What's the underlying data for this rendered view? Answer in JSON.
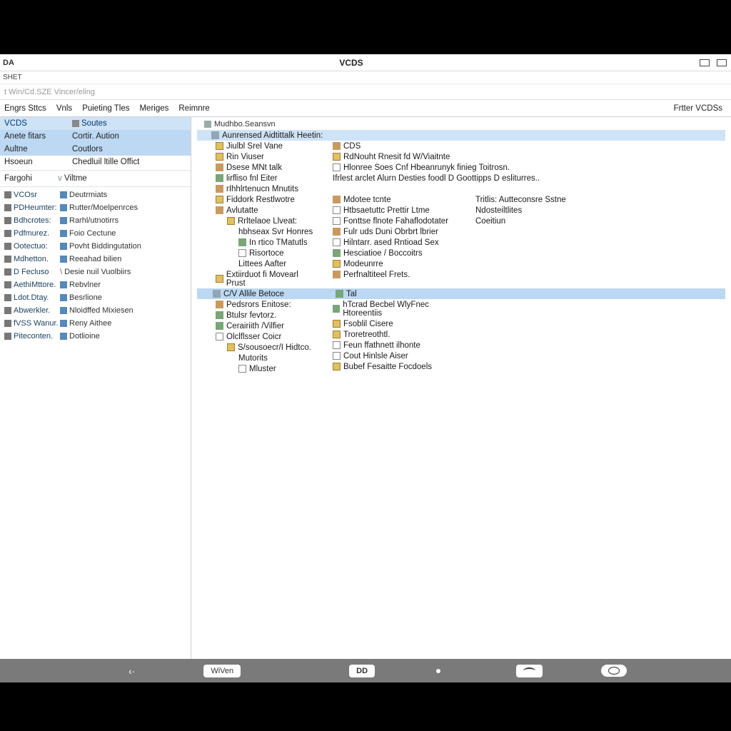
{
  "window": {
    "leftLabel": "DA",
    "title": "VCDS",
    "subtitle": "SHET"
  },
  "pathbar": "t  Win/Cd.SZE  Vincer/eling",
  "menubar": {
    "items": [
      "Engrs Sttcs",
      "Vnls",
      "Puieting Tles",
      "Meriges",
      "Reimnre"
    ],
    "right": "Frtter  VCDSs"
  },
  "leftpane": {
    "head": {
      "a": "VCDS",
      "b": "Soutes"
    },
    "rows": [
      {
        "a": "Anete fitars",
        "b": "Cortir. Aution",
        "sel": true
      },
      {
        "a": "Aultne",
        "b": "Coutlors",
        "sel": true
      },
      {
        "a": "Hsoeun",
        "b": "Chedluil ltille Offict"
      }
    ],
    "sect": {
      "a": "Fargohi",
      "b": "Viltme",
      "icon": "v"
    },
    "pairs": [
      {
        "a": "VCOsr",
        "b": "Deutrmiats"
      },
      {
        "a": "PDHeumter:",
        "b": "Rutter/Moelpenrces"
      },
      {
        "a": "Bdhcrotes:",
        "b": "Rarhl/utnotirrs"
      },
      {
        "a": "Pdfmurez.",
        "b": "Foio Cectune"
      },
      {
        "a": "Ootectuo:",
        "b": "Povht Biddingutation"
      },
      {
        "a": "Mdhetton.",
        "b": "Reeahad bilien"
      },
      {
        "a": "D Fecluso",
        "b": "Desie nuil Vuolbiirs",
        "icon": "slash"
      },
      {
        "a": "AethiMttore.",
        "b": "Rebvlner"
      },
      {
        "a": "Ldot.Dtay.",
        "b": "Besrlione"
      },
      {
        "a": "Abwerkler.",
        "b": "Nloidffed Mixiesen"
      },
      {
        "a": "fVSS Wanur.",
        "b": "Reny Aithee"
      },
      {
        "a": "Piteconten.",
        "b": "Dotlioine"
      }
    ]
  },
  "rightpane": {
    "head": "Mudhbo.Seansvn",
    "sel1": "Aunrensed Aidtittalk Heetin:",
    "tree1": [
      {
        "t": "Jiulbl Srel Vane",
        "i": "f"
      },
      {
        "t": "Rin Viuser",
        "i": "f"
      },
      {
        "t": "Dsese MNt talk",
        "i": "o"
      },
      {
        "t": "lirfliso fnl Eiter",
        "i": "g"
      },
      {
        "t": "rIhhlrtenucn Mnutits",
        "i": "o"
      }
    ],
    "col2top": [
      {
        "t": "CDS",
        "i": "o"
      },
      {
        "t": "RdNouht Rnesit fd W/Viaitnte",
        "i": "f"
      },
      {
        "t": "Hlonree Soes Cnf Hbeanrunyk finieg Toitrosn.",
        "i": "chk"
      },
      {
        "t": "Ifrlest arclet Alurn Desties foodl D Goottipps D esliturres.."
      }
    ],
    "col2mid": [
      {
        "t": "Mdotee tcnte",
        "i": "o"
      },
      {
        "t": "Htbsaetuttc Prettir Ltme",
        "i": "chk"
      },
      {
        "t": "Fonttse flnote Fahaflodotater",
        "i": "chk"
      },
      {
        "t": "Fulr uds Duni Obrbrt lbrier",
        "i": "o"
      },
      {
        "t": "Hilntarr. ased Rntioad Sex",
        "i": "chk"
      },
      {
        "t": "Hesciatioe / Boccoitrs",
        "i": "g"
      },
      {
        "t": "Modeunrre",
        "i": "f"
      },
      {
        "t": "Perfnaltiteel Frets.",
        "i": "o"
      }
    ],
    "col3mid": [
      {
        "t": "Tritlis: Autteconsre Sstne"
      },
      {
        "t": "Ndosteiltlites"
      },
      {
        "t": "Coeitiun"
      }
    ],
    "left2": [
      {
        "t": "Fiddork Restlwotre",
        "i": "f"
      },
      {
        "t": "Avlutatte",
        "i": "o",
        "open": true
      },
      {
        "t": "Rrltelaoe Llveat:",
        "i": "f",
        "ind": 1
      },
      {
        "t": "hbhseax Svr Honres",
        "ind": 2
      },
      {
        "t": "In rtico TMatutls",
        "i": "g",
        "ind": 2
      },
      {
        "t": "Risortoce",
        "i": "chk",
        "ind": 2
      },
      {
        "t": "Littees Aafter",
        "ind": 2
      },
      {
        "t": "Extiirduot fi Movearl Prust",
        "i": "f"
      }
    ],
    "sel2": {
      "a": "C/V Allile Betoce",
      "b": "Tal"
    },
    "left3": [
      {
        "t": "Pedsrors Enitose:",
        "i": "o"
      },
      {
        "t": "Btulsr fevtorz.",
        "i": "g"
      },
      {
        "t": "Cerairiith /Vilfier",
        "i": "g"
      },
      {
        "t": "Olclflsser Coicr",
        "i": "chk",
        "open": true
      },
      {
        "t": "S/sousoecr/I Hidtco.",
        "i": "f",
        "ind": 1
      },
      {
        "t": "Mutorits",
        "ind": 2
      },
      {
        "t": "Mluster",
        "i": "chk",
        "ind": 2
      }
    ],
    "col2bot": [
      {
        "t": "hTcrad Becbel WlyFnec Htoreentiis",
        "i": "g"
      },
      {
        "t": "Fsoblil Cisere",
        "i": "f"
      },
      {
        "t": "Troretreothtl.",
        "i": "f"
      },
      {
        "t": "Feun ffathnett ilhonte",
        "i": "chk"
      },
      {
        "t": "Cout Hinlsle Aiser",
        "i": "chk"
      },
      {
        "t": "Bubef Fesaitte Focdoels",
        "i": "f"
      }
    ]
  },
  "taskbar": {
    "btn1": "WiVen",
    "btn2": "DD"
  }
}
